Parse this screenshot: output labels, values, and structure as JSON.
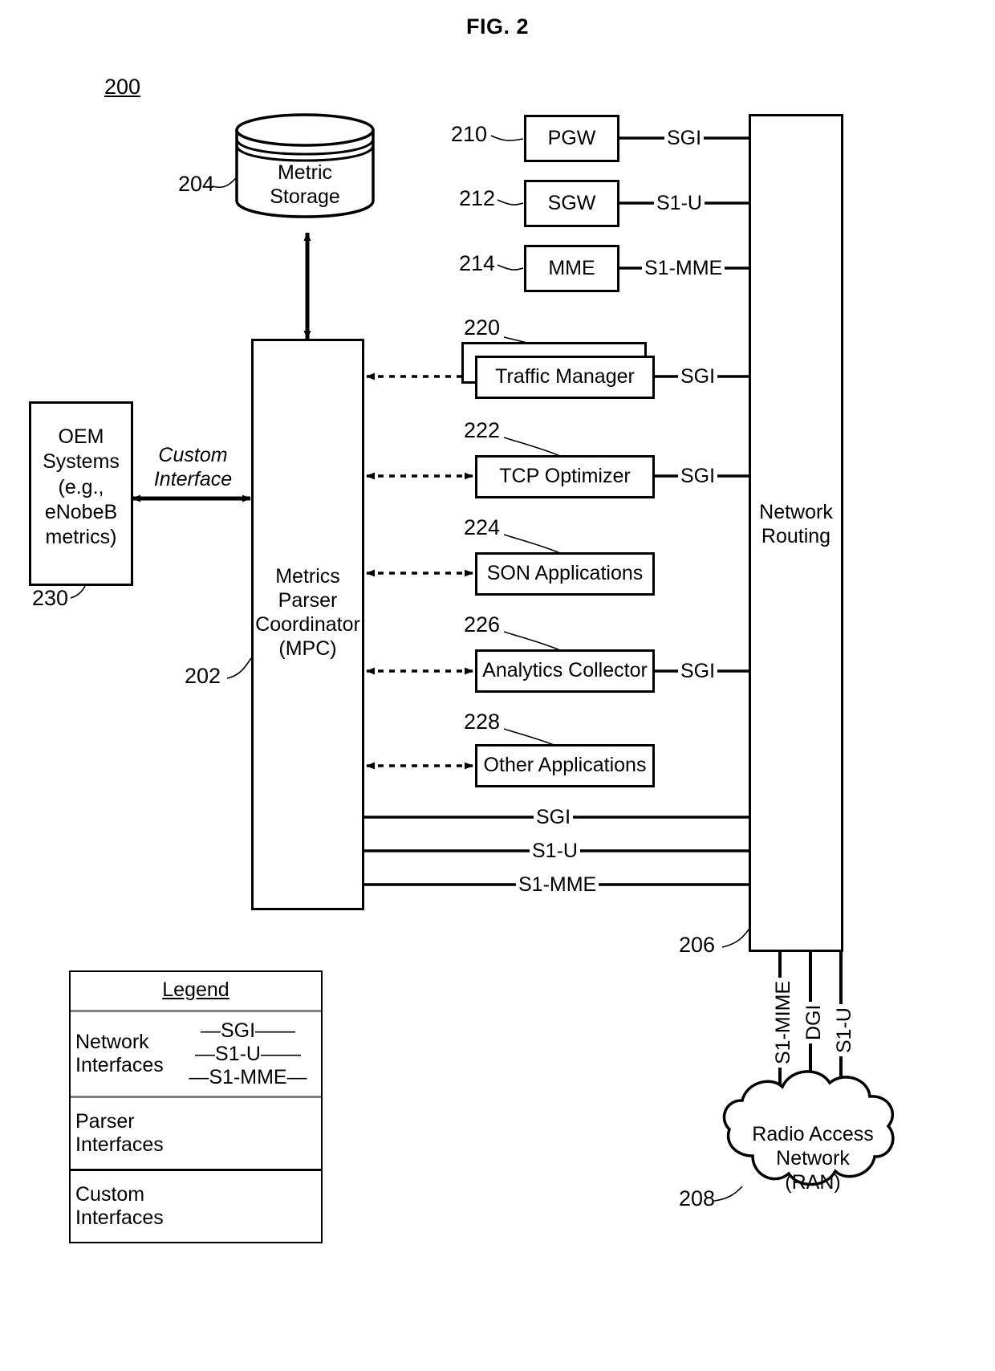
{
  "figure": {
    "title": "FIG. 2",
    "system_ref": "200"
  },
  "nodes": {
    "metric_storage": {
      "label_line1": "Metric",
      "label_line2": "Storage",
      "ref": "204"
    },
    "mpc": {
      "line1": "Metrics",
      "line2": "Parser",
      "line3": "Coordinator",
      "line4": "(MPC)",
      "ref": "202"
    },
    "oem": {
      "line1": "OEM",
      "line2": "Systems",
      "line3": "(e.g.,",
      "line4": "eNobeB",
      "line5": "metrics)",
      "ref": "230"
    },
    "network_routing": {
      "line1": "Network",
      "line2": "Routing",
      "ref": "206"
    },
    "ran": {
      "line1": "Radio Access",
      "line2": "Network",
      "line3": "(RAN)",
      "ref": "208"
    },
    "pgw": {
      "label": "PGW",
      "ref": "210",
      "interface": "SGI"
    },
    "sgw": {
      "label": "SGW",
      "ref": "212",
      "interface": "S1-U"
    },
    "mme": {
      "label": "MME",
      "ref": "214",
      "interface": "S1-MME"
    },
    "traffic_manager": {
      "label": "Traffic Manager",
      "ref": "220",
      "interface": "SGI",
      "stacked": "true"
    },
    "tcp_optimizer": {
      "label": "TCP Optimizer",
      "ref": "222",
      "interface": "SGI"
    },
    "son_applications": {
      "label": "SON Applications",
      "ref": "224",
      "interface": ""
    },
    "analytics_collector": {
      "label": "Analytics Collector",
      "ref": "226",
      "interface": "SGI"
    },
    "other_applications": {
      "label": "Other Applications",
      "ref": "228",
      "interface": ""
    }
  },
  "custom_interface": {
    "line1": "Custom",
    "line2": "Interface"
  },
  "mpc_to_routing_interfaces": [
    {
      "label": "SGI"
    },
    {
      "label": "S1-U"
    },
    {
      "label": "S1-MME"
    }
  ],
  "routing_to_ran_interfaces": [
    {
      "label": "S1-MIME"
    },
    {
      "label": "DGI"
    },
    {
      "label": "S1-U"
    }
  ],
  "legend": {
    "title": "Legend",
    "rows": [
      {
        "name_line1": "Network",
        "name_line2": "Interfaces",
        "sample_line1": "—SGI——",
        "sample_line2": "—S1-U——",
        "sample_line3": "—S1-MME—"
      },
      {
        "name_line1": "Parser",
        "name_line2": "Interfaces",
        "sample_line1": "",
        "sample_line2": "",
        "sample_line3": ""
      },
      {
        "name_line1": "Custom",
        "name_line2": "Interfaces",
        "sample_line1": "",
        "sample_line2": "",
        "sample_line3": ""
      }
    ]
  }
}
